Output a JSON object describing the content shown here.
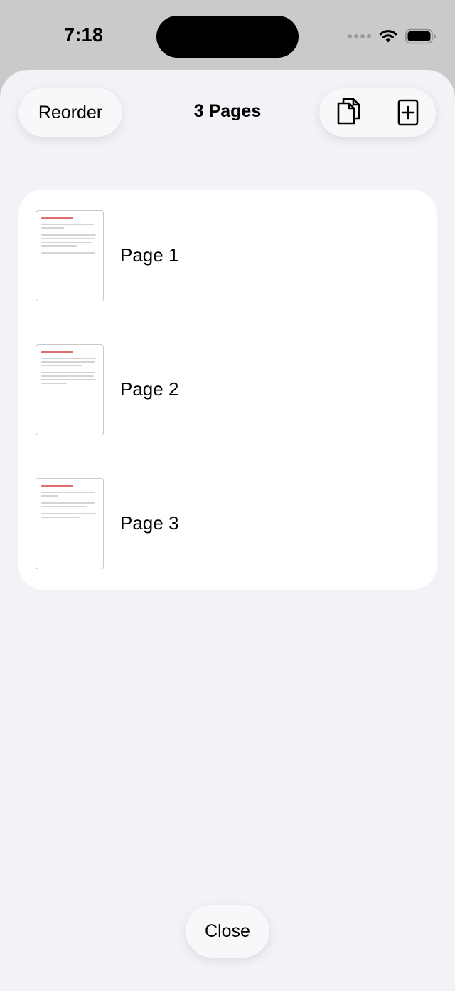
{
  "status_bar": {
    "time": "7:18"
  },
  "toolbar": {
    "reorder_label": "Reorder",
    "title": "3 Pages",
    "duplicate_icon": "duplicate-pages-icon",
    "add_icon": "add-page-icon"
  },
  "pages": [
    {
      "label": "Page 1"
    },
    {
      "label": "Page 2"
    },
    {
      "label": "Page 3"
    }
  ],
  "close_label": "Close",
  "colors": {
    "sheet_background": "#f2f2f7",
    "card_background": "#ffffff",
    "thumbnail_heading": "#e07070"
  }
}
